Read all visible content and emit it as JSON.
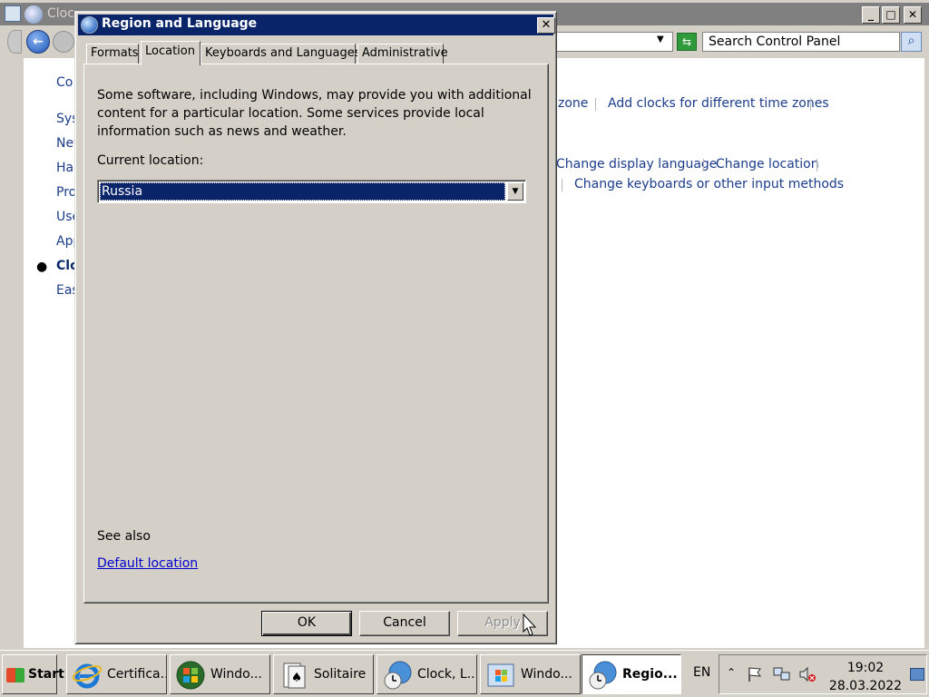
{
  "control_panel": {
    "title": "Cloc",
    "search_placeholder": "Search Control Panel",
    "sidebar": [
      "Co",
      "Sys",
      "Net",
      "Har",
      "Pro",
      "Use",
      "App",
      "Clo",
      "Eas"
    ],
    "links": {
      "row1": [
        "zone",
        "Add clocks for different time zones"
      ],
      "row2": [
        "Change display language",
        "Change location"
      ],
      "row3": [
        "Change keyboards or other input methods"
      ]
    }
  },
  "dialog": {
    "title": "Region and Language",
    "tabs": [
      "Formats",
      "Location",
      "Keyboards and Languages",
      "Administrative"
    ],
    "active_tab": "Location",
    "description": "Some software, including Windows, may provide you with additional content for a particular location. Some services provide local information such as news and weather.",
    "current_location_label": "Current location:",
    "current_location_value": "Russia",
    "see_also": "See also",
    "default_location_link": "Default location",
    "buttons": {
      "ok": "OK",
      "cancel": "Cancel",
      "apply": "Apply"
    }
  },
  "taskbar": {
    "start": "Start",
    "tasks": [
      "Certifica...",
      "Windo...",
      "Solitaire",
      "Clock, L...",
      "Windo...",
      "Regio..."
    ],
    "language": "EN",
    "time": "19:02",
    "date": "28.03.2022"
  },
  "colors": {
    "title_active": "#0a246a",
    "title_inactive": "#808080",
    "link": "#1a3c8a",
    "face": "#d4d0c8"
  }
}
